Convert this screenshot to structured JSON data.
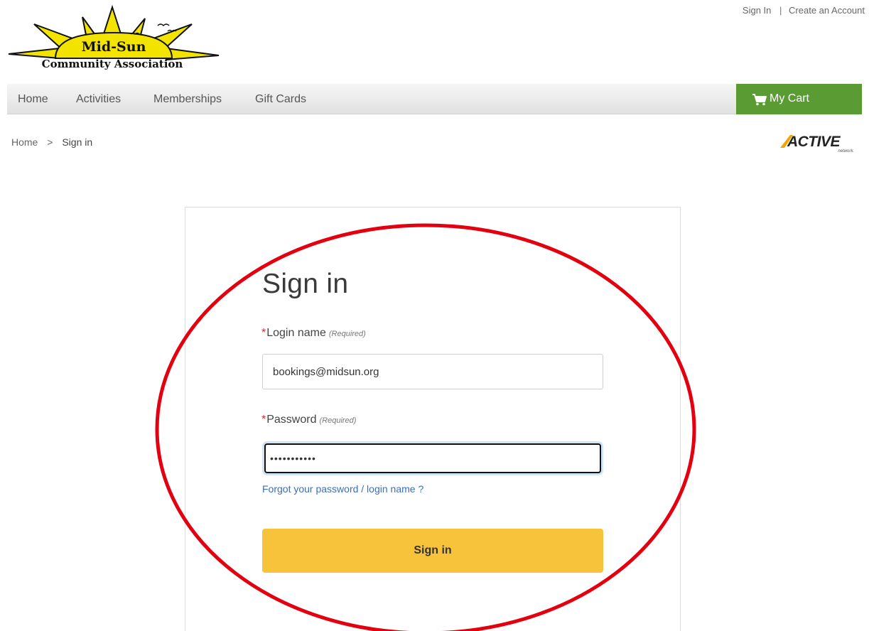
{
  "logo": {
    "name_line1": "Mid-Sun",
    "name_line2": "Community Association"
  },
  "top_links": {
    "sign_in": "Sign In",
    "separator": "|",
    "create_account": "Create an Account"
  },
  "nav": {
    "items": [
      {
        "label": "Home"
      },
      {
        "label": "Activities"
      },
      {
        "label": "Memberships"
      },
      {
        "label": "Gift Cards"
      }
    ],
    "cart_label": "My Cart",
    "cart_icon": "shopping-cart-icon",
    "cart_color": "#5a9b34"
  },
  "breadcrumb": {
    "home": "Home",
    "separator": ">",
    "current": "Sign in"
  },
  "brand": {
    "name": "ACTIVE",
    "tagline": "network."
  },
  "form": {
    "title": "Sign in",
    "required_star": "*",
    "login": {
      "label": "Login name",
      "required": "(Required)",
      "value": "bookings@midsun.org"
    },
    "password": {
      "label": "Password",
      "required": "(Required)",
      "value": "•••••••••••"
    },
    "forgot_link": "Forgot your password / login name ?",
    "submit_label": "Sign in",
    "submit_color": "#f7c33b"
  },
  "annotation": {
    "shape": "ellipse",
    "color": "#e3000f"
  }
}
